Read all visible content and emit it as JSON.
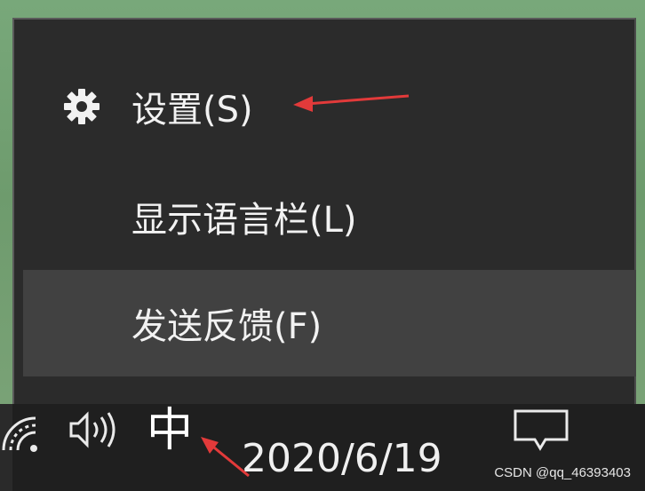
{
  "context_menu": {
    "items": [
      {
        "label": "设置(S)",
        "icon": "gear-icon"
      },
      {
        "label": "显示语言栏(L)"
      },
      {
        "label": "发送反馈(F)",
        "highlighted": true
      }
    ]
  },
  "taskbar": {
    "tray_icons": [
      "network-wifi-icon",
      "speaker-volume-icon",
      "notification-icon"
    ],
    "ime_indicator": "中",
    "date": "2020/6/19"
  },
  "watermark": "CSDN @qq_46393403",
  "colors": {
    "menu_background": "#2b2b2b",
    "menu_hover": "#414141",
    "taskbar": "#1f1f1f",
    "annotation_arrow": "#e23a3a"
  }
}
